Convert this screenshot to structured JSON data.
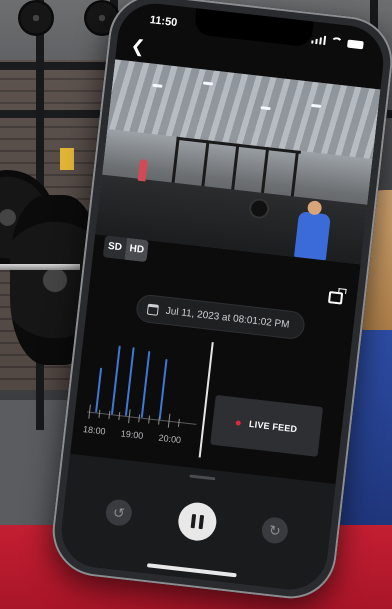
{
  "status_bar": {
    "time": "11:50"
  },
  "player": {
    "quality_options": [
      "SD",
      "HD"
    ],
    "selected_quality": "HD"
  },
  "timestamp": {
    "text": "Jul 11, 2023 at 08:01:02 PM"
  },
  "timeline": {
    "labels": [
      "18:00",
      "19:00",
      "20:00"
    ],
    "live_label": "LIVE FEED"
  },
  "colors": {
    "accent_blue": "#3f79d8",
    "live_red": "#e0283d",
    "floor_red": "#c41f32"
  },
  "icons": [
    "back-arrow-icon",
    "signal-icon",
    "wifi-icon",
    "battery-icon",
    "calendar-icon",
    "clip-icon",
    "rewind-icon",
    "pause-icon",
    "forward-icon"
  ]
}
